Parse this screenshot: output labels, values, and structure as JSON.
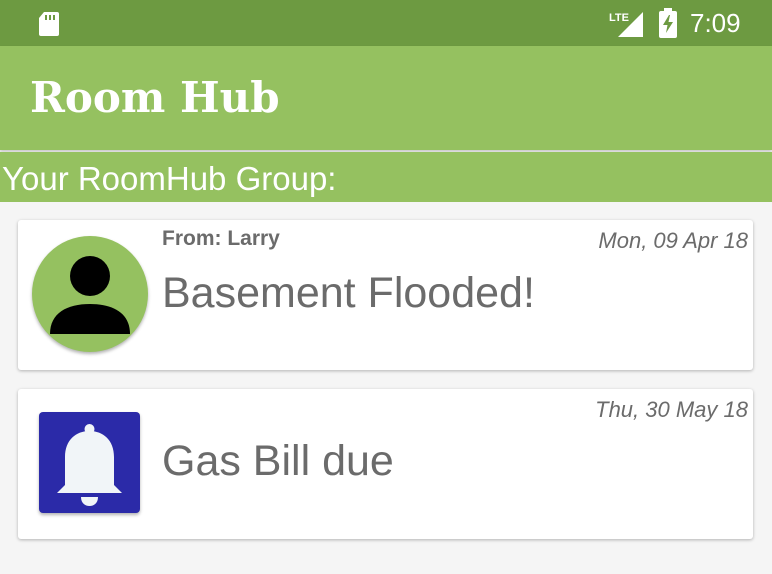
{
  "status_bar": {
    "time": "7:09",
    "network": "LTE",
    "icons": [
      "sd-card-icon",
      "lte-signal-icon",
      "battery-charging-icon"
    ]
  },
  "app_bar": {
    "title": "Room Hub"
  },
  "group": {
    "header": "Your RoomHub Group:"
  },
  "messages": [
    {
      "from": "From: Larry",
      "date": "Mon, 09 Apr 18",
      "subject": "Basement Flooded!",
      "icon": "person-avatar-icon"
    },
    {
      "date": "Thu, 30 May 18",
      "subject": "Gas Bill due",
      "icon": "bell-icon"
    }
  ],
  "colors": {
    "status_bar": "#6d9a41",
    "app_bar": "#95c160",
    "text_secondary": "#6b6b6b",
    "bell_tile": "#2b2aa8"
  }
}
